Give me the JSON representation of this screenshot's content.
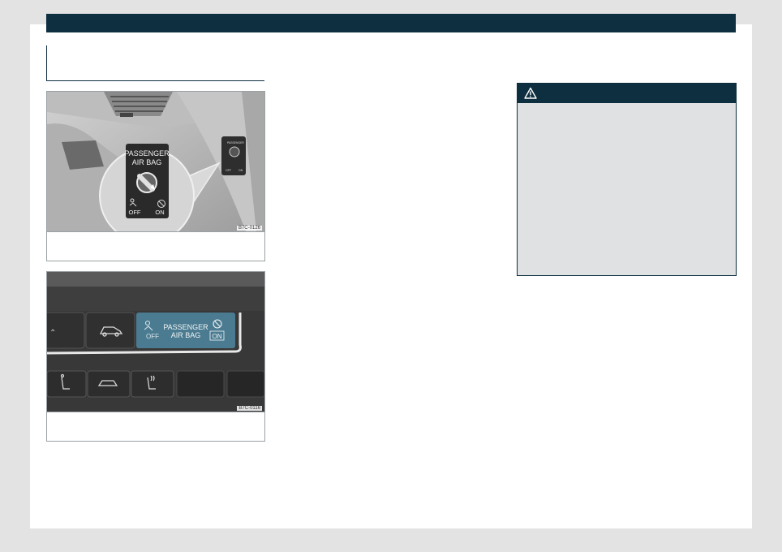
{
  "figures": [
    {
      "code": "B7C-0126",
      "label_passenger": "PASSENGER",
      "label_airbag": "AIR BAG",
      "label_off": "OFF",
      "label_on": "ON",
      "small_off": "OFF",
      "small_on": "ON"
    },
    {
      "code": "B7C-0116",
      "label_passenger": "PASSENGER",
      "label_airbag": "AIR BAG",
      "label_off": "OFF",
      "label_on": "ON"
    }
  ],
  "warning": {
    "icon": "warning-triangle-icon"
  },
  "colors": {
    "header": "#0d2f40",
    "warning_bg": "#dfe1e3",
    "switch_panel": "#4b7b90"
  }
}
